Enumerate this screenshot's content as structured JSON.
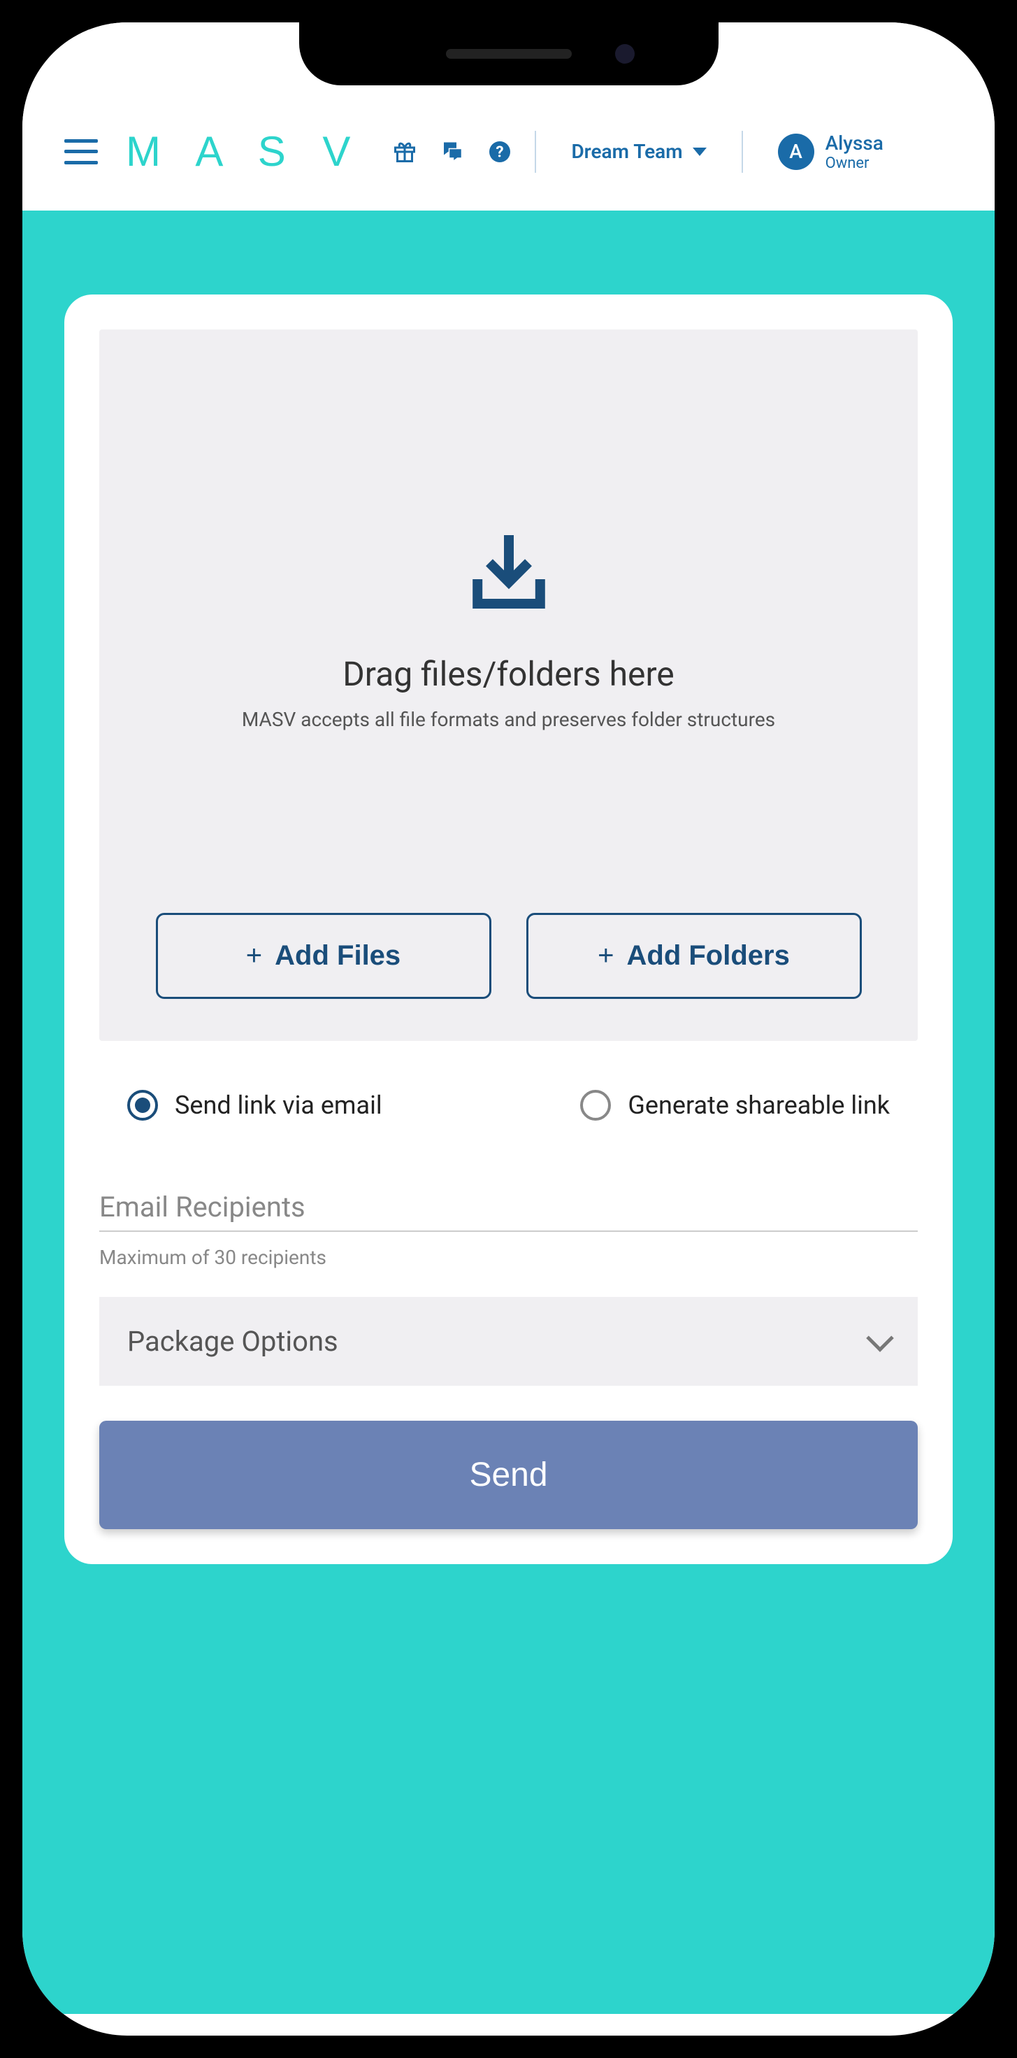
{
  "brand": "M A S V",
  "team": {
    "name": "Dream Team"
  },
  "user": {
    "initial": "A",
    "name": "Alyssa",
    "role": "Owner"
  },
  "dropzone": {
    "title": "Drag files/folders here",
    "subtitle": "MASV accepts all file formats and preserves folder structures",
    "add_files": "Add Files",
    "add_folders": "Add Folders"
  },
  "share_options": {
    "email": "Send link via email",
    "link": "Generate shareable link",
    "selected": "email"
  },
  "recipients": {
    "label": "Email Recipients",
    "hint": "Maximum of 30 recipients"
  },
  "package": {
    "label": "Package Options"
  },
  "send_label": "Send"
}
